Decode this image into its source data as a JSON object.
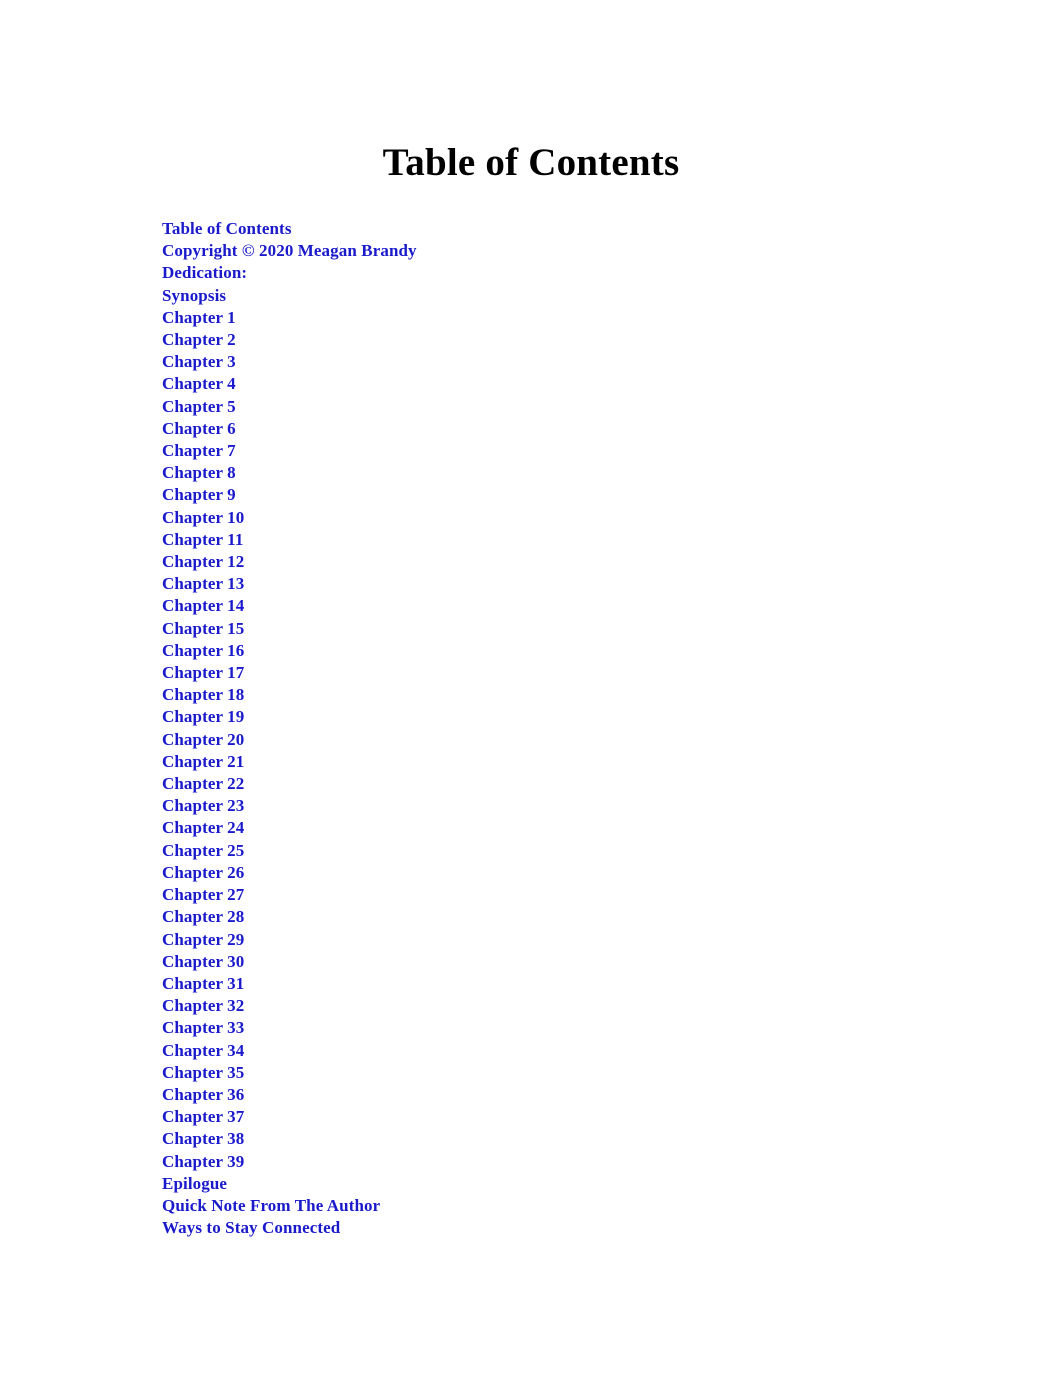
{
  "document": {
    "title": "Table of Contents",
    "link_color": "#1A1ACC",
    "title_color": "#000000",
    "background_color": "#FFFFFF"
  },
  "toc": {
    "entries": [
      "Table of Contents",
      "Copyright © 2020 Meagan Brandy",
      "Dedication:",
      "Synopsis",
      "Chapter 1",
      "Chapter 2",
      "Chapter 3",
      "Chapter 4",
      "Chapter 5",
      "Chapter 6",
      "Chapter 7",
      "Chapter 8",
      "Chapter 9",
      "Chapter 10",
      "Chapter 11",
      "Chapter 12",
      "Chapter 13",
      "Chapter 14",
      "Chapter 15",
      "Chapter 16",
      "Chapter 17",
      "Chapter 18",
      "Chapter 19",
      "Chapter 20",
      "Chapter 21",
      "Chapter 22",
      "Chapter 23",
      "Chapter 24",
      "Chapter 25",
      "Chapter 26",
      "Chapter 27",
      "Chapter 28",
      "Chapter 29",
      "Chapter 30",
      "Chapter 31",
      "Chapter 32",
      "Chapter 33",
      "Chapter 34",
      "Chapter 35",
      "Chapter 36",
      "Chapter 37",
      "Chapter 38",
      "Chapter 39",
      "Epilogue",
      "Quick Note From The Author",
      "Ways to Stay Connected"
    ]
  }
}
